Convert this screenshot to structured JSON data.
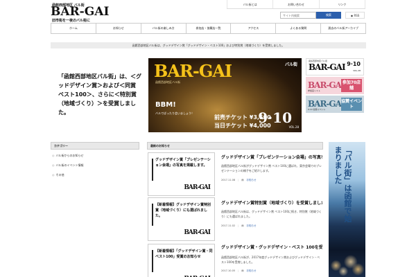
{
  "header": {
    "logo_small": "函館西部地区 バル街",
    "logo_main": "BAR-GAI",
    "logo_tagline": "旧市街を一夜のバル街に",
    "top_links": [
      "バル街とは",
      "お問い合わせ",
      "リンク"
    ],
    "search_placeholder": "サイト内検索",
    "search_button": "検索",
    "rss": "RSS"
  },
  "nav": {
    "items": [
      "ホーム",
      "お知らせ",
      "バル街の楽しみ方",
      "参加店・協賛店一覧",
      "アクセス",
      "よくある質問",
      "過去のバル街アーカイブ"
    ]
  },
  "notice": "函館西部地区バル街は、グッドデザイン賞「グッドデザイン・ベスト100」および特別賞（地域づくり）を受賞しました。",
  "award": {
    "text": "「函館西部地区バル街」は、＜グッドデザイン賞＞および＜同賞ベスト100＞、さらに＜特別賞（地域づくり）＞を受賞しました。"
  },
  "main_banner": {
    "title": "BAR-GAI",
    "logo": "バル街",
    "sub": "函館西部地区バル街",
    "bbm": "BBM!",
    "bbm_sub": "バルでぱったり会いましょう！",
    "price_advance": "前売チケット ¥3,500",
    "price_door": "当日チケット ¥4,000",
    "date": "9·10",
    "vol": "VOL.28"
  },
  "side_banners": [
    {
      "meta": "函館西部地区バル街",
      "title": "BAR-GAI",
      "date": "9·10",
      "vol": "VOL.28"
    },
    {
      "title": "BAR-GAI",
      "badge": "参加70店舗",
      "small": "参加店リスト"
    },
    {
      "title": "BAR-GAI",
      "badge": "協賛イベント",
      "small": "9.10 協賛イベント"
    }
  ],
  "sidebar": {
    "heading": "カテゴリー",
    "items": [
      "バル街からのお知らせ",
      "バル街のイベント情報",
      "その他"
    ]
  },
  "news": {
    "heading": "最新のお知らせ",
    "items": [
      {
        "thumb_text": "グッドデザイン賞「プレゼンテーション会場」の写真を掲載します。",
        "title": "グッドデザイン賞「プレゼンテーション会場」の写真を掲載しました",
        "desc": "函館西部地区バル街がグッドデザイン賞 ベスト100に選ばれ、東京会場でのプレゼンテーションの様子をご紹介します。",
        "date": "2017.11.08",
        "category": "お知らせ"
      },
      {
        "thumb_text": "【新着情報】グッドデザイン賞特別賞（地域づくり）にも選ばれました。",
        "title": "グッドデザイン賞特別賞（地域づくり）を受賞しました",
        "desc": "函館西部地区バル街は、グッドデザイン賞 ベスト100に続き、特別賞（地域づくり）にも選ばれました。",
        "date": "2017.11.02",
        "category": "お知らせ"
      },
      {
        "thumb_text": "【新着情報】「グッドデザイン賞・同ベスト100」受賞のお知らせ",
        "title": "グッドデザイン賞・グッドデザイン・ベスト 100を受賞しました",
        "desc": "函館西部地区バル街が、2017年度グッドデザイン賞およびグッドデザイン・ベスト100を受賞しました。",
        "date": "2017.10.05",
        "category": "お知らせ"
      }
    ]
  },
  "night_banner": {
    "text": "「バル街」は函館で始まりました"
  }
}
